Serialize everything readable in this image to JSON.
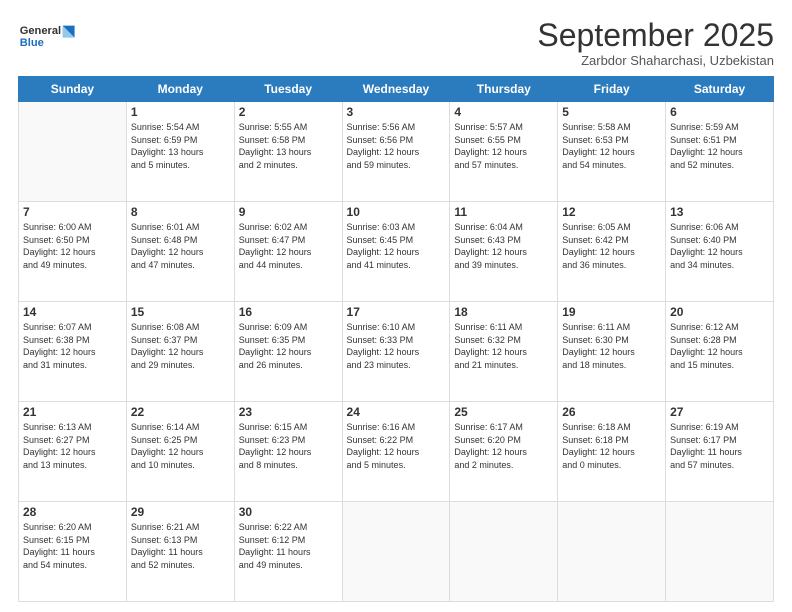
{
  "header": {
    "logo_general": "General",
    "logo_blue": "Blue",
    "month": "September 2025",
    "location": "Zarbdor Shaharchasi, Uzbekistan"
  },
  "days_of_week": [
    "Sunday",
    "Monday",
    "Tuesday",
    "Wednesday",
    "Thursday",
    "Friday",
    "Saturday"
  ],
  "weeks": [
    [
      {
        "day": "",
        "info": ""
      },
      {
        "day": "1",
        "info": "Sunrise: 5:54 AM\nSunset: 6:59 PM\nDaylight: 13 hours\nand 5 minutes."
      },
      {
        "day": "2",
        "info": "Sunrise: 5:55 AM\nSunset: 6:58 PM\nDaylight: 13 hours\nand 2 minutes."
      },
      {
        "day": "3",
        "info": "Sunrise: 5:56 AM\nSunset: 6:56 PM\nDaylight: 12 hours\nand 59 minutes."
      },
      {
        "day": "4",
        "info": "Sunrise: 5:57 AM\nSunset: 6:55 PM\nDaylight: 12 hours\nand 57 minutes."
      },
      {
        "day": "5",
        "info": "Sunrise: 5:58 AM\nSunset: 6:53 PM\nDaylight: 12 hours\nand 54 minutes."
      },
      {
        "day": "6",
        "info": "Sunrise: 5:59 AM\nSunset: 6:51 PM\nDaylight: 12 hours\nand 52 minutes."
      }
    ],
    [
      {
        "day": "7",
        "info": "Sunrise: 6:00 AM\nSunset: 6:50 PM\nDaylight: 12 hours\nand 49 minutes."
      },
      {
        "day": "8",
        "info": "Sunrise: 6:01 AM\nSunset: 6:48 PM\nDaylight: 12 hours\nand 47 minutes."
      },
      {
        "day": "9",
        "info": "Sunrise: 6:02 AM\nSunset: 6:47 PM\nDaylight: 12 hours\nand 44 minutes."
      },
      {
        "day": "10",
        "info": "Sunrise: 6:03 AM\nSunset: 6:45 PM\nDaylight: 12 hours\nand 41 minutes."
      },
      {
        "day": "11",
        "info": "Sunrise: 6:04 AM\nSunset: 6:43 PM\nDaylight: 12 hours\nand 39 minutes."
      },
      {
        "day": "12",
        "info": "Sunrise: 6:05 AM\nSunset: 6:42 PM\nDaylight: 12 hours\nand 36 minutes."
      },
      {
        "day": "13",
        "info": "Sunrise: 6:06 AM\nSunset: 6:40 PM\nDaylight: 12 hours\nand 34 minutes."
      }
    ],
    [
      {
        "day": "14",
        "info": "Sunrise: 6:07 AM\nSunset: 6:38 PM\nDaylight: 12 hours\nand 31 minutes."
      },
      {
        "day": "15",
        "info": "Sunrise: 6:08 AM\nSunset: 6:37 PM\nDaylight: 12 hours\nand 29 minutes."
      },
      {
        "day": "16",
        "info": "Sunrise: 6:09 AM\nSunset: 6:35 PM\nDaylight: 12 hours\nand 26 minutes."
      },
      {
        "day": "17",
        "info": "Sunrise: 6:10 AM\nSunset: 6:33 PM\nDaylight: 12 hours\nand 23 minutes."
      },
      {
        "day": "18",
        "info": "Sunrise: 6:11 AM\nSunset: 6:32 PM\nDaylight: 12 hours\nand 21 minutes."
      },
      {
        "day": "19",
        "info": "Sunrise: 6:11 AM\nSunset: 6:30 PM\nDaylight: 12 hours\nand 18 minutes."
      },
      {
        "day": "20",
        "info": "Sunrise: 6:12 AM\nSunset: 6:28 PM\nDaylight: 12 hours\nand 15 minutes."
      }
    ],
    [
      {
        "day": "21",
        "info": "Sunrise: 6:13 AM\nSunset: 6:27 PM\nDaylight: 12 hours\nand 13 minutes."
      },
      {
        "day": "22",
        "info": "Sunrise: 6:14 AM\nSunset: 6:25 PM\nDaylight: 12 hours\nand 10 minutes."
      },
      {
        "day": "23",
        "info": "Sunrise: 6:15 AM\nSunset: 6:23 PM\nDaylight: 12 hours\nand 8 minutes."
      },
      {
        "day": "24",
        "info": "Sunrise: 6:16 AM\nSunset: 6:22 PM\nDaylight: 12 hours\nand 5 minutes."
      },
      {
        "day": "25",
        "info": "Sunrise: 6:17 AM\nSunset: 6:20 PM\nDaylight: 12 hours\nand 2 minutes."
      },
      {
        "day": "26",
        "info": "Sunrise: 6:18 AM\nSunset: 6:18 PM\nDaylight: 12 hours\nand 0 minutes."
      },
      {
        "day": "27",
        "info": "Sunrise: 6:19 AM\nSunset: 6:17 PM\nDaylight: 11 hours\nand 57 minutes."
      }
    ],
    [
      {
        "day": "28",
        "info": "Sunrise: 6:20 AM\nSunset: 6:15 PM\nDaylight: 11 hours\nand 54 minutes."
      },
      {
        "day": "29",
        "info": "Sunrise: 6:21 AM\nSunset: 6:13 PM\nDaylight: 11 hours\nand 52 minutes."
      },
      {
        "day": "30",
        "info": "Sunrise: 6:22 AM\nSunset: 6:12 PM\nDaylight: 11 hours\nand 49 minutes."
      },
      {
        "day": "",
        "info": ""
      },
      {
        "day": "",
        "info": ""
      },
      {
        "day": "",
        "info": ""
      },
      {
        "day": "",
        "info": ""
      }
    ]
  ]
}
